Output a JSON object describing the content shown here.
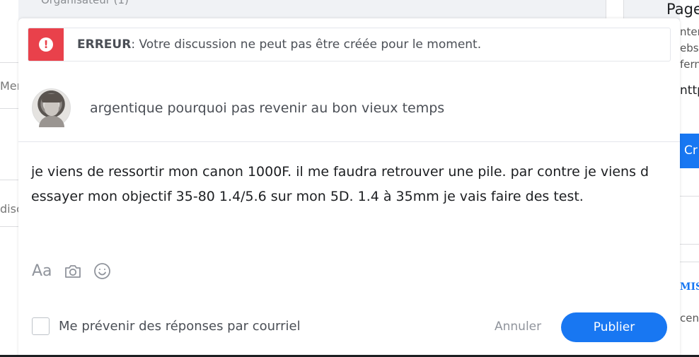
{
  "background": {
    "top_text": "Organisateur (1)",
    "left_labels": [
      "Mer",
      "disc"
    ],
    "right_title": "Page",
    "right_lines": [
      "nter",
      "ebs",
      "fern",
      "nttp"
    ],
    "right_button": "Cr",
    "right_blue_text": "MIS",
    "right_bottom_text": "cen"
  },
  "error": {
    "icon": "exclamation-icon",
    "prefix": "ERREUR",
    "message": ": Votre discussion ne peut pas être créée pour le moment."
  },
  "topic": {
    "title": "argentique pourquoi pas revenir au bon vieux temps"
  },
  "post": {
    "body": "je viens de ressortir mon canon 1000F. il me faudra retrouver une pile. par contre je viens d essayer mon objectif 35-80 1.4/5.6 sur mon 5D.   1.4 à 35mm je vais faire des test."
  },
  "toolbar": {
    "font_label": "Aa",
    "camera_icon": "camera-icon",
    "emoji_icon": "emoji-icon"
  },
  "footer": {
    "notify_label": "Me prévenir des réponses par courriel",
    "cancel_label": "Annuler",
    "publish_label": "Publier"
  },
  "colors": {
    "error_red": "#e9414b",
    "primary_blue": "#1877f2"
  }
}
